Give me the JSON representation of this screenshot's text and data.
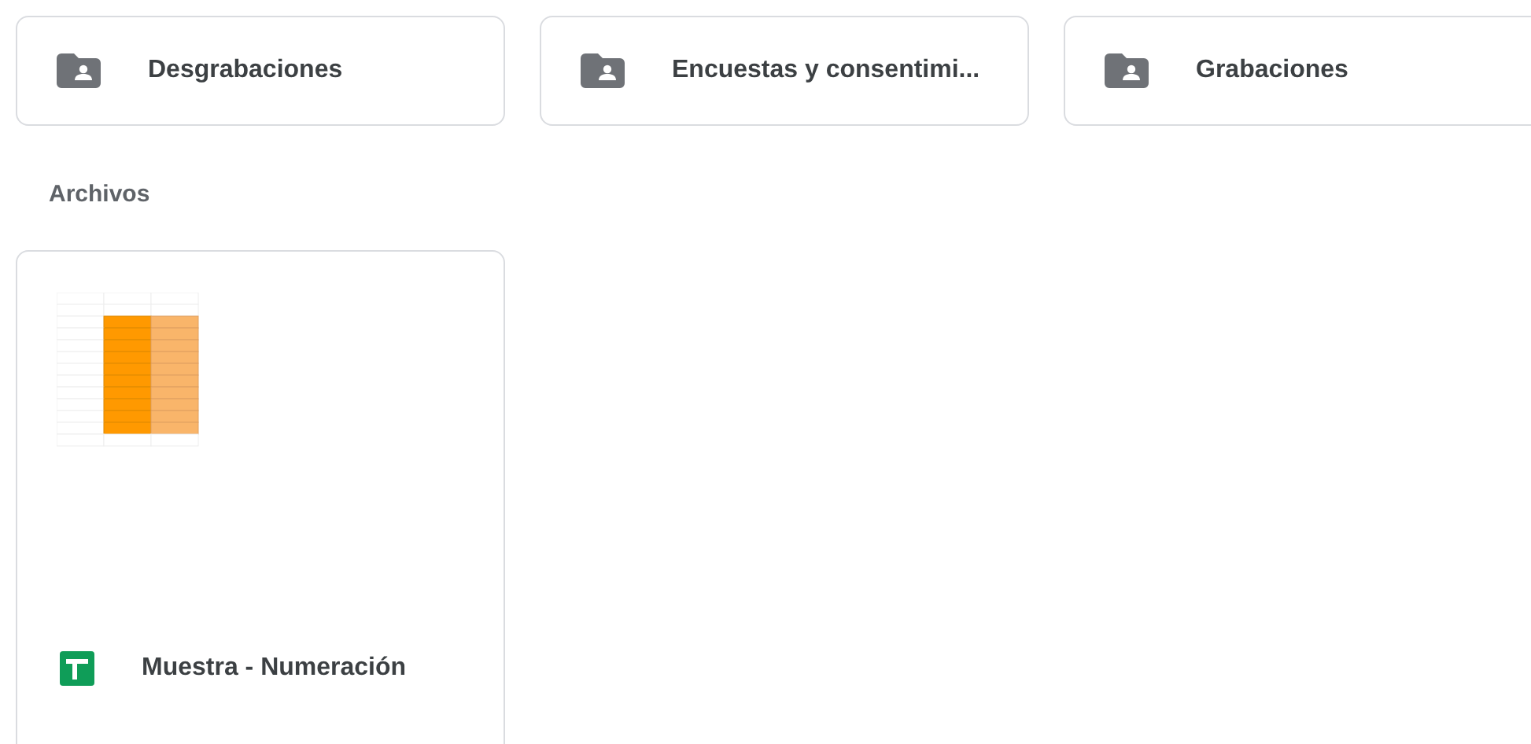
{
  "folders": [
    {
      "name": "Desgrabaciones"
    },
    {
      "name": "Encuestas y consentimi..."
    },
    {
      "name": "Grabaciones"
    }
  ],
  "files_heading": "Archivos",
  "files": [
    {
      "name": "Muestra - Numeración"
    }
  ]
}
